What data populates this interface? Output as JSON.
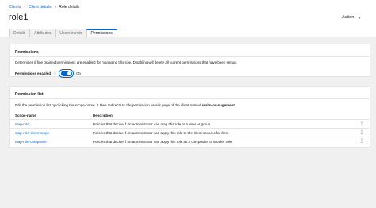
{
  "breadcrumb": {
    "items": [
      "Clients",
      "Client details",
      "Role details"
    ]
  },
  "page": {
    "title": "role1",
    "action_label": "Action"
  },
  "tabs": [
    {
      "label": "Details",
      "active": false
    },
    {
      "label": "Attributes",
      "active": false
    },
    {
      "label": "Users in role",
      "active": false
    },
    {
      "label": "Permissions",
      "active": true
    }
  ],
  "permissions_card": {
    "title": "Permissions",
    "description": "Determines if fine grained permissions are enabled for managing this role. Disabling will delete all current permissions that have been set up.",
    "toggle_label": "Permissions enabled",
    "toggle_state": "On",
    "toggle_on": true
  },
  "permission_list": {
    "title": "Permission list",
    "description_prefix": "Edit the permission list by clicking the scope-name. It then redirects to the permission details page of the client named ",
    "client_name": "realm-management",
    "columns": [
      "Scope-name",
      "Description"
    ],
    "rows": [
      {
        "name": "map-role",
        "description": "Policies that decide if an administrator can map this role to a user or group"
      },
      {
        "name": "map-role-client-scope",
        "description": "Policies that decide if an administrator can apply this role to the client scope of a client"
      },
      {
        "name": "map-role-composite",
        "description": "Policies that decide if an administrator can apply this role as a composite to another role"
      }
    ]
  },
  "colors": {
    "accent": "#0066cc",
    "background": "#f0f0f0",
    "card": "#ffffff"
  }
}
